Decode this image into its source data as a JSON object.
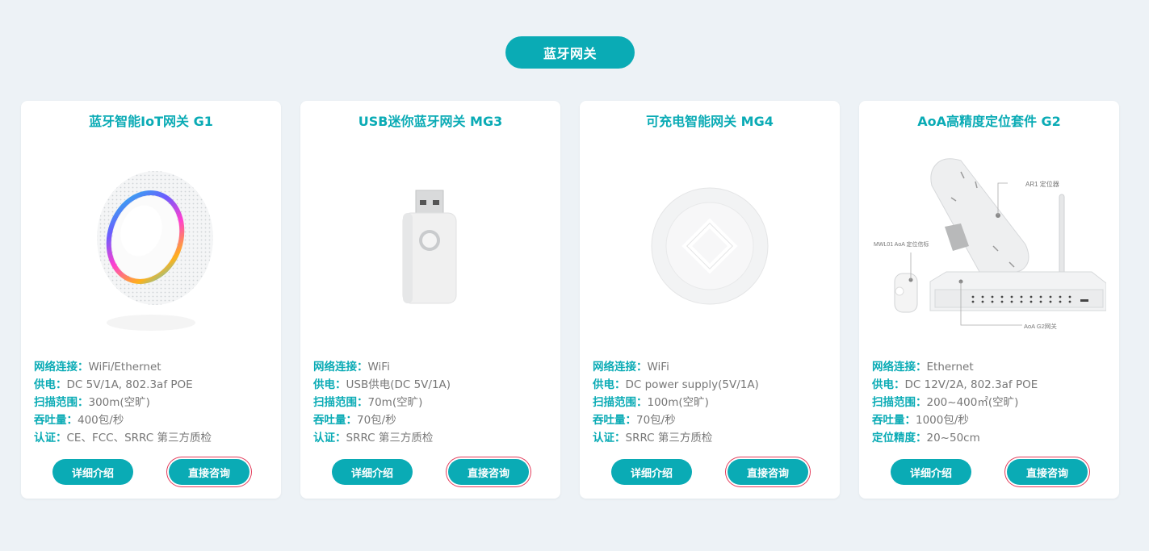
{
  "section": {
    "title": "蓝牙网关"
  },
  "colors": {
    "accent": "#0aabb5",
    "background": "#edf2f6"
  },
  "cards": [
    {
      "title": "蓝牙智能IoT网关 G1",
      "image_icon": "round-ceiling-gateway-icon",
      "specs": [
        {
          "label": "网络连接：",
          "value": "WiFi/Ethernet"
        },
        {
          "label": "供电：",
          "value": "DC 5V/1A, 802.3af POE"
        },
        {
          "label": "扫描范围：",
          "value": "300m(空旷)"
        },
        {
          "label": "吞吐量：",
          "value": "400包/秒"
        },
        {
          "label": "认证：",
          "value": "CE、FCC、SRRC 第三方质检"
        }
      ],
      "detail_label": "详细介绍",
      "consult_label": "直接咨询"
    },
    {
      "title": "USB迷你蓝牙网关 MG3",
      "image_icon": "usb-dongle-icon",
      "specs": [
        {
          "label": "网络连接：",
          "value": "WiFi"
        },
        {
          "label": "供电：",
          "value": "USB供电(DC 5V/1A)"
        },
        {
          "label": "扫描范围：",
          "value": "70m(空旷)"
        },
        {
          "label": "吞吐量：",
          "value": "70包/秒"
        },
        {
          "label": "认证：",
          "value": "SRRC 第三方质检"
        }
      ],
      "detail_label": "详细介绍",
      "consult_label": "直接咨询"
    },
    {
      "title": "可充电智能网关 MG4",
      "image_icon": "round-puck-gateway-icon",
      "specs": [
        {
          "label": "网络连接：",
          "value": "WiFi"
        },
        {
          "label": "供电：",
          "value": "DC power supply(5V/1A)"
        },
        {
          "label": "扫描范围：",
          "value": "100m(空旷)"
        },
        {
          "label": "吞吐量：",
          "value": "70包/秒"
        },
        {
          "label": "认证：",
          "value": "SRRC 第三方质检"
        }
      ],
      "detail_label": "详细介绍",
      "consult_label": "直接咨询"
    },
    {
      "title": "AoA高精度定位套件 G2",
      "image_icon": "aoa-kit-icon",
      "image_labels": {
        "locator": "AR1 定位器",
        "beacon": "MWL01 AoA 定位信标",
        "gateway": "AoA G2网关"
      },
      "specs": [
        {
          "label": "网络连接：",
          "value": "Ethernet"
        },
        {
          "label": "供电：",
          "value": "DC 12V/2A, 802.3af POE"
        },
        {
          "label": "扫描范围：",
          "value": "200~400㎡(空旷)"
        },
        {
          "label": "吞吐量：",
          "value": "1000包/秒"
        },
        {
          "label": "定位精度：",
          "value": "20~50cm"
        }
      ],
      "detail_label": "详细介绍",
      "consult_label": "直接咨询"
    }
  ]
}
